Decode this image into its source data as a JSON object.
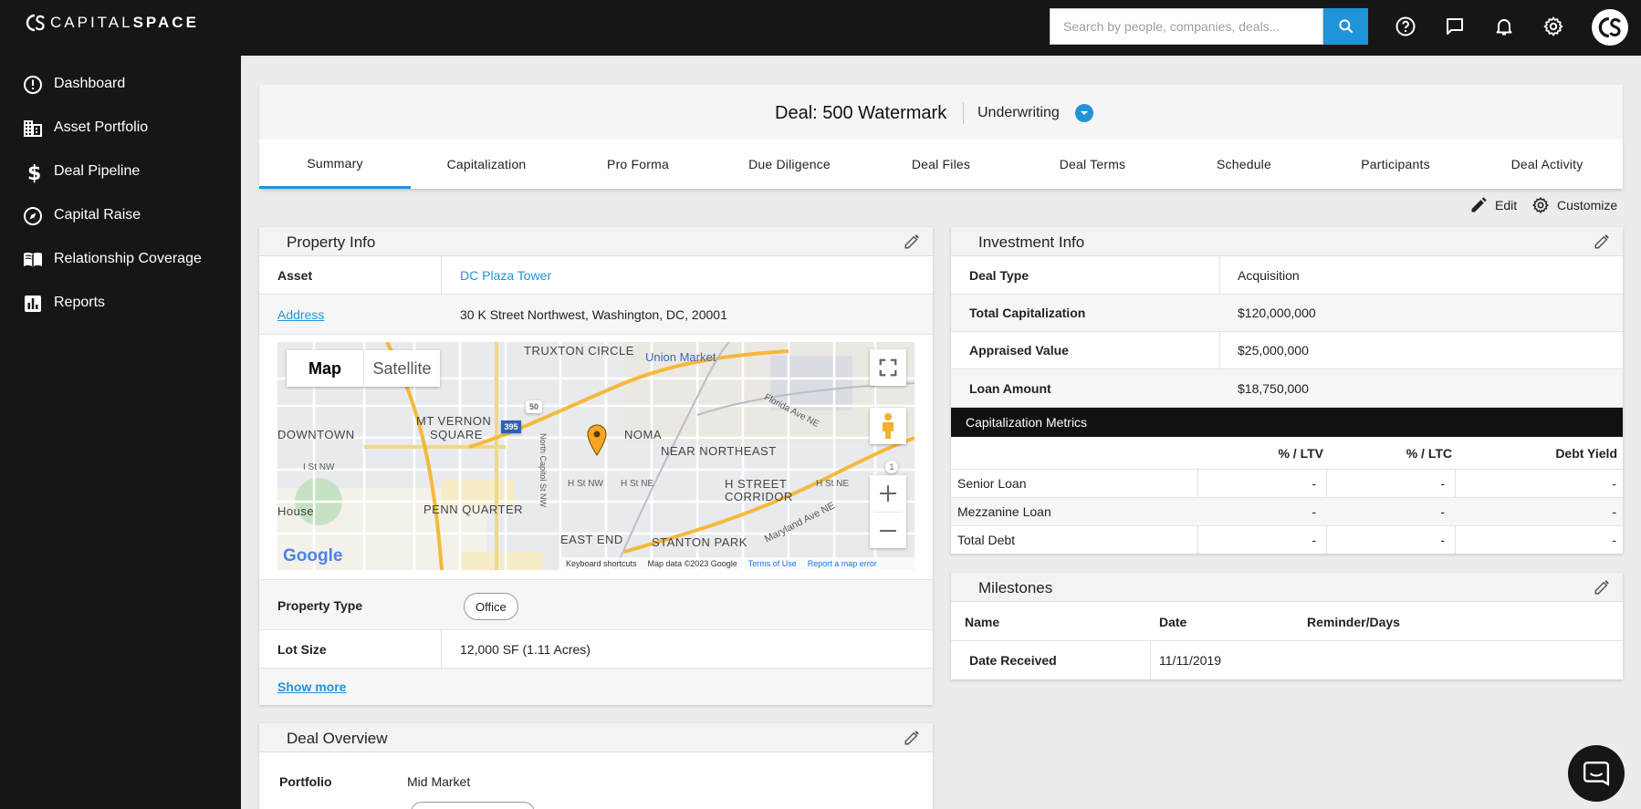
{
  "brand": {
    "logo_text_light": "CAPITAL",
    "logo_text_bold": "SPACE"
  },
  "topbar": {
    "search_placeholder": "Search by people, companies, deals...",
    "icons": [
      "search-icon",
      "help-icon",
      "chat-icon",
      "bell-icon",
      "gear-icon",
      "avatar"
    ]
  },
  "sidebar": {
    "items": [
      {
        "label": "Dashboard",
        "icon": "info-circle-icon"
      },
      {
        "label": "Asset Portfolio",
        "icon": "building-icon"
      },
      {
        "label": "Deal Pipeline",
        "icon": "dollar-icon"
      },
      {
        "label": "Capital Raise",
        "icon": "compass-icon"
      },
      {
        "label": "Relationship Coverage",
        "icon": "book-icon"
      },
      {
        "label": "Reports",
        "icon": "chart-icon"
      }
    ]
  },
  "deal": {
    "title": "Deal: 500 Watermark",
    "stage": "Underwriting"
  },
  "tabs": [
    "Summary",
    "Capitalization",
    "Pro Forma",
    "Due Diligence",
    "Deal Files",
    "Deal Terms",
    "Schedule",
    "Participants",
    "Deal Activity"
  ],
  "actions": {
    "edit": "Edit",
    "customize": "Customize"
  },
  "property": {
    "title": "Property Info",
    "asset_label": "Asset",
    "asset_value": "DC Plaza Tower",
    "address_label": "Address",
    "address_value": "30 K Street Northwest, Washington, DC, 20001",
    "type_label": "Property Type",
    "type_value": "Office",
    "lot_label": "Lot Size",
    "lot_value": "12,000 SF (1.11 Acres)",
    "show_more": "Show more"
  },
  "map": {
    "toggle": [
      "Map",
      "Satellite"
    ],
    "labels": [
      "TRUXTON CIRCLE",
      "Union Market",
      "MT VERNON",
      "SQUARE",
      "NOMA",
      "DOWNTOWN",
      "NEAR NORTHEAST",
      "H STREET",
      "CORRIDOR",
      "PENN QUARTER",
      "EAST END",
      "STANTON PARK",
      "Florida Ave NE",
      "Maryland Ave NE",
      "H St NW",
      "H St NE",
      "North Capitol St NW",
      "House",
      "I St NW"
    ],
    "shields": [
      "50",
      "395",
      "1"
    ],
    "brand": "Google",
    "footer": [
      "Keyboard shortcuts",
      "Map data ©2023 Google",
      "Terms of Use",
      "Report a map error"
    ]
  },
  "investment": {
    "title": "Investment Info",
    "rows": [
      {
        "label": "Deal Type",
        "value": "Acquisition"
      },
      {
        "label": "Total Capitalization",
        "value": "$120,000,000"
      },
      {
        "label": "Appraised Value",
        "value": "$25,000,000"
      },
      {
        "label": "Loan Amount",
        "value": "$18,750,000"
      }
    ],
    "metrics_title": "Capitalization Metrics",
    "metrics_headers": [
      "% / LTV",
      "% / LTC",
      "Debt Yield"
    ],
    "metrics_rows": [
      {
        "name": "Senior Loan",
        "ltv": "-",
        "ltc": "-",
        "dy": "-"
      },
      {
        "name": "Mezzanine Loan",
        "ltv": "-",
        "ltc": "-",
        "dy": "-"
      },
      {
        "name": "Total Debt",
        "ltv": "-",
        "ltc": "-",
        "dy": "-"
      }
    ]
  },
  "milestones": {
    "title": "Milestones",
    "headers": [
      "Name",
      "Date",
      "Reminder/Days"
    ],
    "rows": [
      {
        "name": "Date Received",
        "date": "11/11/2019",
        "reminder": ""
      }
    ]
  },
  "overview": {
    "title": "Deal Overview",
    "portfolio_label": "Portfolio",
    "portfolio_value": "Mid Market"
  },
  "colors": {
    "accent": "#1f94d8",
    "dark": "#161616",
    "panel_head": "#f3f3f3",
    "marker": "#f5a623"
  }
}
